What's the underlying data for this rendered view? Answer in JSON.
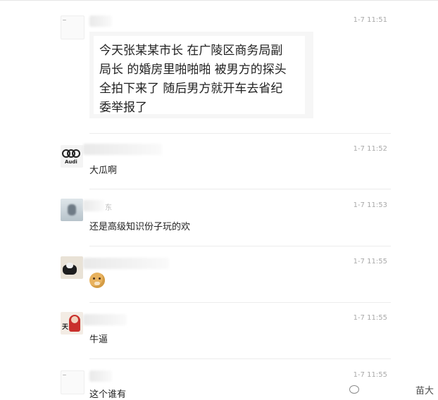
{
  "messages": [
    {
      "avatar_text": "一",
      "timestamp": "1-7 11:51",
      "content": "今天张某某市长 在广陵区商务局副\n局长 的婚房里啪啪啪 被男方的探头\n全拍下来了 随后男方就开车去省纪\n委举报了"
    },
    {
      "avatar_text": "Audi",
      "timestamp": "1-7 11:52",
      "content": "大瓜啊"
    },
    {
      "timestamp": "1-7 11:53",
      "name_fragment": "东",
      "content": "还是高级知识份子玩的欢"
    },
    {
      "timestamp": "1-7 11:55",
      "emoji": "doge"
    },
    {
      "avatar_text": "天",
      "timestamp": "1-7 11:55",
      "content": "牛逼"
    },
    {
      "avatar_text": "一",
      "timestamp": "1-7 11:55",
      "content": "这个谁有"
    }
  ],
  "colors": {
    "timestamp": "#a9a9a9",
    "divider": "#ececec",
    "bubble_bg": "#f6f6f6"
  },
  "watermark": "苗大"
}
